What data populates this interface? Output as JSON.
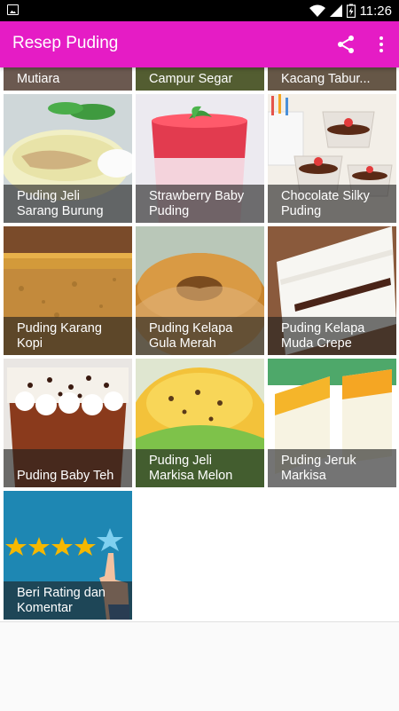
{
  "status_bar": {
    "time": "11:26",
    "left_icon": "image-notification-icon",
    "battery_icon": "battery-charging-icon"
  },
  "app_bar": {
    "title": "Resep Puding",
    "share_icon": "share-icon",
    "more_icon": "more-vert-icon"
  },
  "recipes": [
    {
      "label": "Mutiara"
    },
    {
      "label": "Campur Segar"
    },
    {
      "label": "Kacang Tabur..."
    },
    {
      "label": "Puding Jeli\nSarang Burung"
    },
    {
      "label": "Strawberry Baby\nPuding"
    },
    {
      "label": "Chocolate Silky\nPuding"
    },
    {
      "label": "Puding Karang\nKopi"
    },
    {
      "label": "Puding Kelapa\nGula Merah"
    },
    {
      "label": "Puding Kelapa\nMuda Crepe"
    },
    {
      "label": "Puding Baby Teh"
    },
    {
      "label": "Puding Jeli\nMarkisa Melon"
    },
    {
      "label": "Puding Jeruk\nMarkisa"
    },
    {
      "label": "Beri Rating dan\nKomentar"
    }
  ]
}
